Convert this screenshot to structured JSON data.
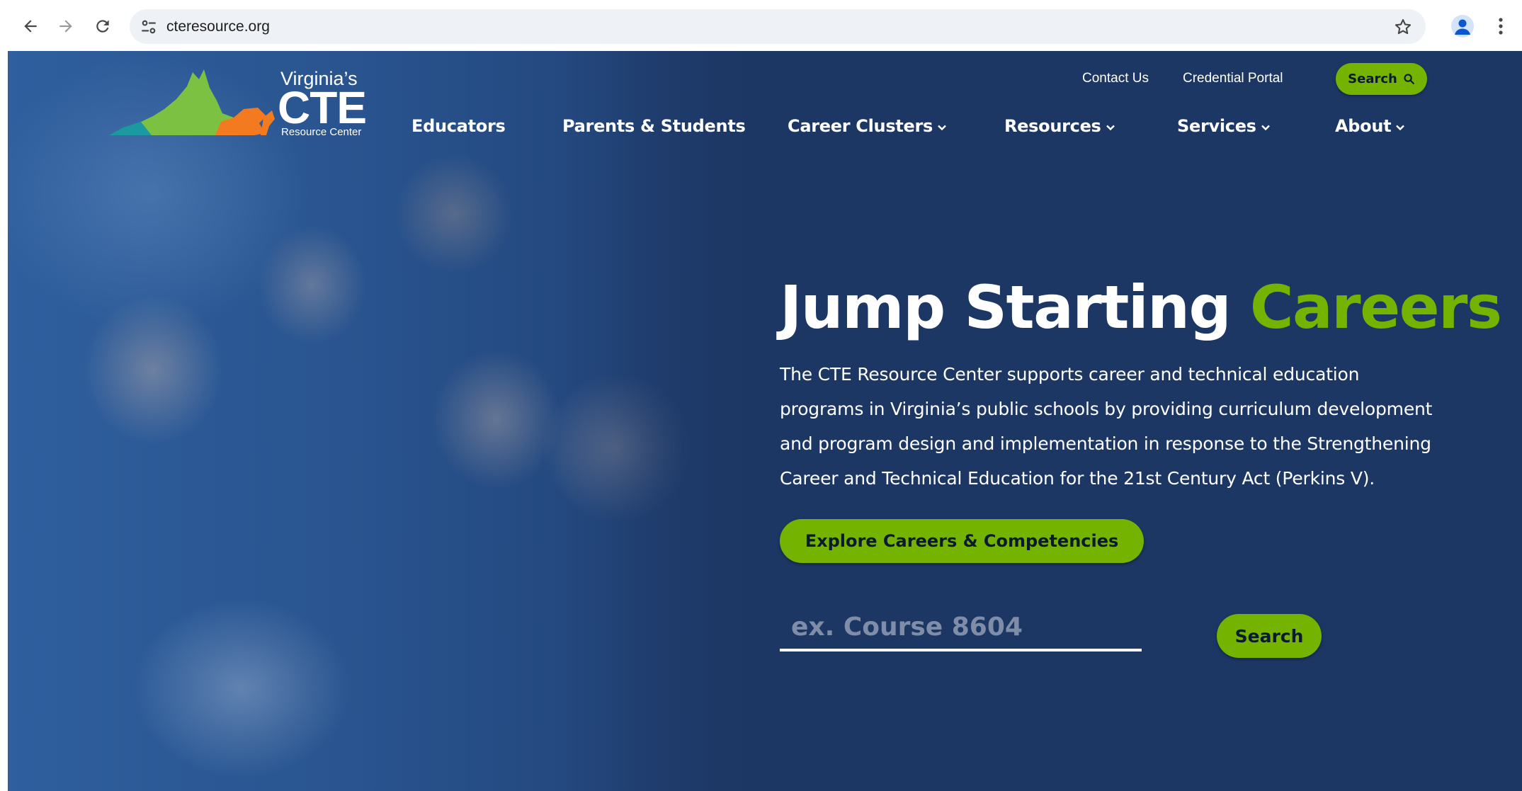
{
  "browser": {
    "url": "cteresource.org",
    "back_icon": "arrow-left-icon",
    "forward_icon": "arrow-right-icon",
    "reload_icon": "reload-icon",
    "site_info_icon": "tune-icon",
    "bookmark_icon": "star-icon",
    "profile_icon": "person-icon",
    "menu_icon": "kebab-menu-icon"
  },
  "logo": {
    "line1": "Virginia’s",
    "line2": "CTE",
    "line3": "Resource Center",
    "colors": {
      "orange": "#f47a20",
      "green": "#7cc142",
      "teal": "#1a9aa0"
    }
  },
  "utility_nav": {
    "contact": "Contact Us",
    "credential": "Credential Portal",
    "search": "Search",
    "search_icon": "search-icon"
  },
  "main_nav": {
    "items": [
      {
        "label": "Educators",
        "dropdown": false
      },
      {
        "label": "Parents & Students",
        "dropdown": false
      },
      {
        "label": "Career Clusters",
        "dropdown": true
      },
      {
        "label": "Resources",
        "dropdown": true
      },
      {
        "label": "Services",
        "dropdown": true
      },
      {
        "label": "About",
        "dropdown": true
      }
    ]
  },
  "hero": {
    "title_main": "Jump Starting",
    "title_accent": "Careers",
    "description": "The CTE Resource Center supports career and technical education programs in Virginia’s public schools by providing curriculum development and program design and implementation in response to the Strengthening Career and Technical Education for the 21st Century Act (Perkins V).",
    "cta_label": "Explore Careers & Competencies",
    "search_placeholder": "ex. Course 8604",
    "search_value": "",
    "search_button": "Search"
  },
  "colors": {
    "navy": "#1d3764",
    "accent_green": "#74b400",
    "button_text": "#0b1a2f"
  }
}
